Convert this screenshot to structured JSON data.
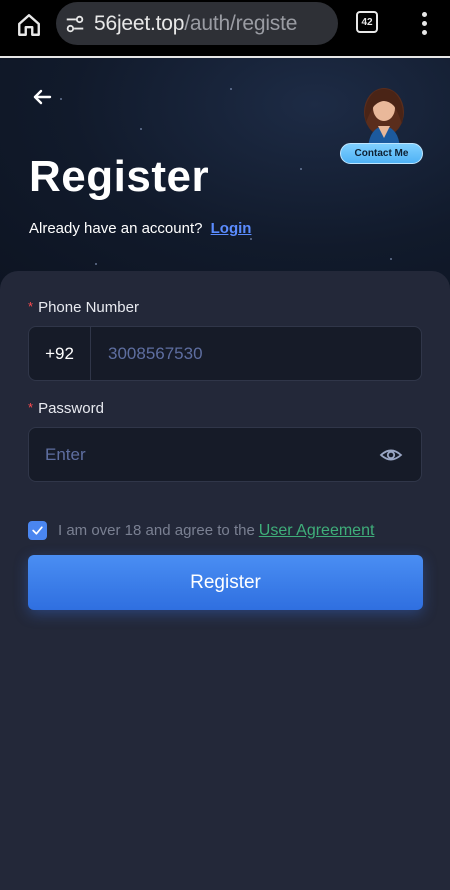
{
  "browser": {
    "url_domain": "56jeet.top",
    "url_path": "/auth/registe",
    "tab_count": "42"
  },
  "header": {
    "title": "Register",
    "account_prompt": "Already have an account?",
    "login_label": "Login",
    "contact_label": "Contact Me"
  },
  "form": {
    "phone_label": "Phone Number",
    "country_code": "+92",
    "phone_placeholder": "3008567530",
    "password_label": "Password",
    "password_placeholder": "Enter",
    "agree_text": "I am over 18 and agree to the",
    "agree_link": "User Agreement",
    "agree_checked": true,
    "submit_label": "Register"
  },
  "colors": {
    "accent": "#4a86f0",
    "link_green": "#3fae7a",
    "required": "#ff4d4f",
    "background": "#232839"
  },
  "icons": [
    "home-icon",
    "tune-icon",
    "tabs-icon",
    "more-vert-icon",
    "back-arrow-icon",
    "eye-icon",
    "check-icon"
  ]
}
